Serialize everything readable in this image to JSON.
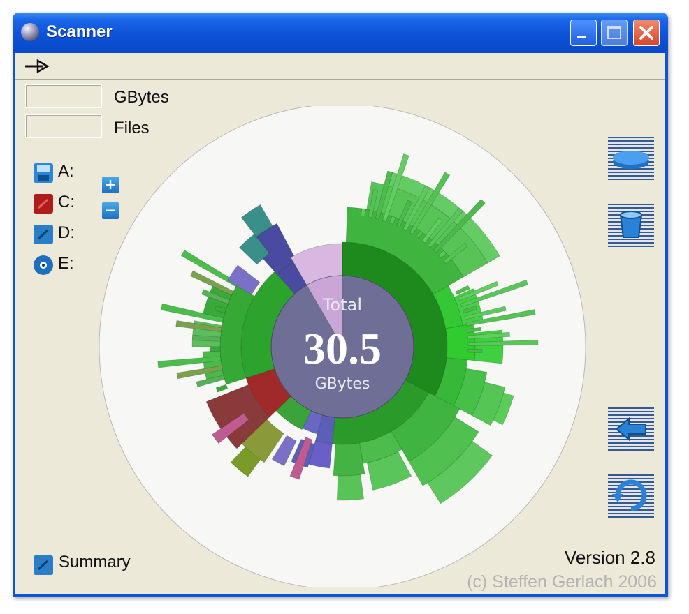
{
  "window": {
    "title": "Scanner"
  },
  "stats": {
    "gbytes_label": "GBytes",
    "files_label": "Files",
    "gbytes_value": "",
    "files_value": ""
  },
  "drives": [
    {
      "label": "A:",
      "icon": "floppy-icon",
      "color": "#2a86d6"
    },
    {
      "label": "C:",
      "icon": "hard-disk-icon",
      "color": "#b01c1c"
    },
    {
      "label": "D:",
      "icon": "disk-icon",
      "color": "#2a7ec8"
    },
    {
      "label": "E:",
      "icon": "cd-icon",
      "color": "#1f6fc0"
    }
  ],
  "zoom": {
    "in_label": "+",
    "out_label": "−"
  },
  "center": {
    "top": "Total",
    "value": "30.5",
    "unit": "GBytes"
  },
  "summary": {
    "label": "Summary"
  },
  "footer": {
    "version": "Version 2.8",
    "copyright": "(c) Steffen Gerlach 2006"
  },
  "sunburst": {
    "rings": [
      {
        "segments": [
          {
            "start": 0,
            "end": 120,
            "color": "#1e8a1e",
            "depth": 1
          },
          {
            "start": 120,
            "end": 185,
            "color": "#2da12d",
            "depth": 2
          },
          {
            "start": 185,
            "end": 205,
            "color": "#6060c0",
            "depth": 1
          },
          {
            "start": 205,
            "end": 230,
            "color": "#3aa43a",
            "depth": 1
          },
          {
            "start": 230,
            "end": 258,
            "color": "#b0373a",
            "depth": 1
          },
          {
            "start": 258,
            "end": 330,
            "color": "#38a038",
            "depth": 1
          },
          {
            "start": 330,
            "end": 360,
            "color": "#d8b8e0",
            "depth": 0
          }
        ]
      }
    ],
    "colors": {
      "outer_green": "#5dc85d",
      "light_green": "#7fe07f",
      "bright_green": "#36d036",
      "purple": "#5b5fb8",
      "teal": "#3b8f8a",
      "red": "#a02a2a",
      "olive": "#8a9a3a",
      "pink": "#c05a90",
      "center_disk": "#6e6e96"
    }
  }
}
